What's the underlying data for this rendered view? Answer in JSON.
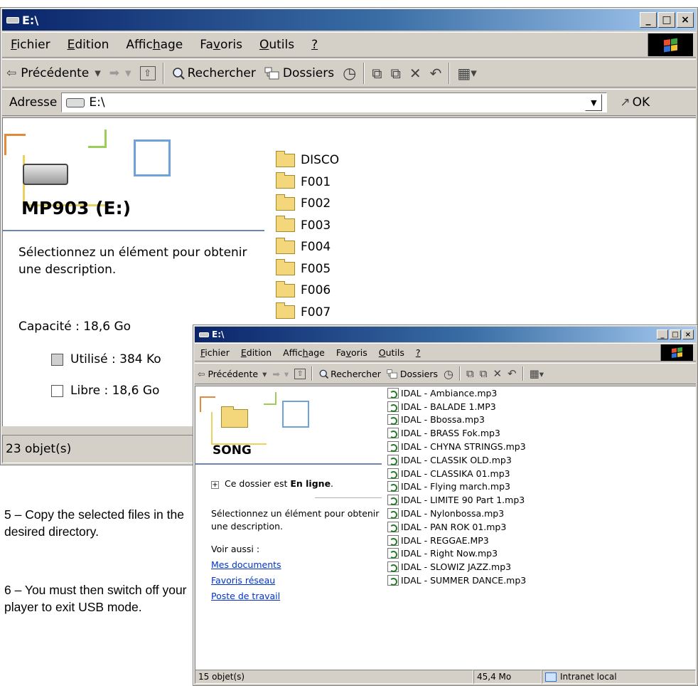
{
  "window_back": {
    "title": "E:\\",
    "controls": [
      "_",
      "□",
      "×"
    ],
    "menu": [
      {
        "pre": "",
        "u": "F",
        "post": "ichier"
      },
      {
        "pre": "",
        "u": "E",
        "post": "dition"
      },
      {
        "pre": "Affic",
        "u": "h",
        "post": "age"
      },
      {
        "pre": "Fa",
        "u": "v",
        "post": "oris"
      },
      {
        "pre": "",
        "u": "O",
        "post": "utils"
      },
      {
        "pre": "",
        "u": "?",
        "post": ""
      }
    ],
    "toolbar": {
      "back_label": "Précédente",
      "back_icon": "⇦",
      "dropdown": "▾",
      "forward_icon": "➡",
      "up_icon": "⇧",
      "search_label": "Rechercher",
      "folders_label": "Dossiers",
      "history_icon": "◷",
      "move_icon": "⧉",
      "copy_icon": "⧉",
      "delete_icon": "✕",
      "undo_icon": "↶",
      "views_icon": "▦"
    },
    "address": {
      "label": "Adresse",
      "value": "E:\\",
      "dropdown": "▼",
      "go_icon": "↗",
      "go_label": "OK"
    },
    "info_panel": {
      "title": "MP903 (E:)",
      "hint": "Sélectionnez un élément pour obtenir une description.",
      "capacity": "Capacité : 18,6 Go",
      "used": "Utilisé :  384 Ko",
      "free": "Libre :  18,6 Go",
      "used_color": "#cfcfcf",
      "free_color": "#ffffff"
    },
    "folders": [
      "DISCO",
      "F001",
      "F002",
      "F003",
      "F004",
      "F005",
      "F006",
      "F007"
    ],
    "status": "23 objet(s)"
  },
  "window_front": {
    "title": "E:\\",
    "controls": [
      "_",
      "□",
      "×"
    ],
    "menu": [
      {
        "pre": "",
        "u": "F",
        "post": "ichier"
      },
      {
        "pre": "",
        "u": "E",
        "post": "dition"
      },
      {
        "pre": "Affic",
        "u": "h",
        "post": "age"
      },
      {
        "pre": "Fa",
        "u": "v",
        "post": "oris"
      },
      {
        "pre": "",
        "u": "O",
        "post": "utils"
      },
      {
        "pre": "",
        "u": "?",
        "post": ""
      }
    ],
    "toolbar": {
      "back_label": "Précédente",
      "search_label": "Rechercher",
      "folders_label": "Dossiers"
    },
    "info_panel": {
      "title": "SONG",
      "online_pre": "Ce dossier est ",
      "online_bold": "En ligne",
      "online_post": ".",
      "expander": "+",
      "hint": "Sélectionnez un élément pour obtenir une description.",
      "see_also": "Voir aussi :",
      "links": [
        "Mes documents",
        "Favoris réseau",
        "Poste de travail"
      ]
    },
    "files": [
      "IDAL - Ambiance.mp3",
      "IDAL - BALADE 1.MP3",
      "IDAL - Bbossa.mp3",
      "IDAL - BRASS Fok.mp3",
      "IDAL - CHYNA STRINGS.mp3",
      "IDAL - CLASSIK OLD.mp3",
      "IDAL - CLASSIKA 01.mp3",
      "IDAL - Flying march.mp3",
      "IDAL - LIMITE 90 Part 1.mp3",
      "IDAL - Nylonbossa.mp3",
      "IDAL - PAN ROK 01.mp3",
      "IDAL - REGGAE.MP3",
      "IDAL - Right Now.mp3",
      "IDAL - SLOWIZ JAZZ.mp3",
      "IDAL - SUMMER DANCE.mp3"
    ],
    "status": {
      "count": "15 objet(s)",
      "size": "45,4 Mo",
      "zone": "Intranet local"
    }
  },
  "instructions": {
    "step5": "5 – Copy the selected files in the desired directory.",
    "step6": "6 – You must then switch off your player to exit USB mode."
  },
  "colors": {
    "title_start": "#0a246a",
    "title_end": "#a6caf0",
    "chrome": "#d4d0c8",
    "link": "#0033cc"
  }
}
